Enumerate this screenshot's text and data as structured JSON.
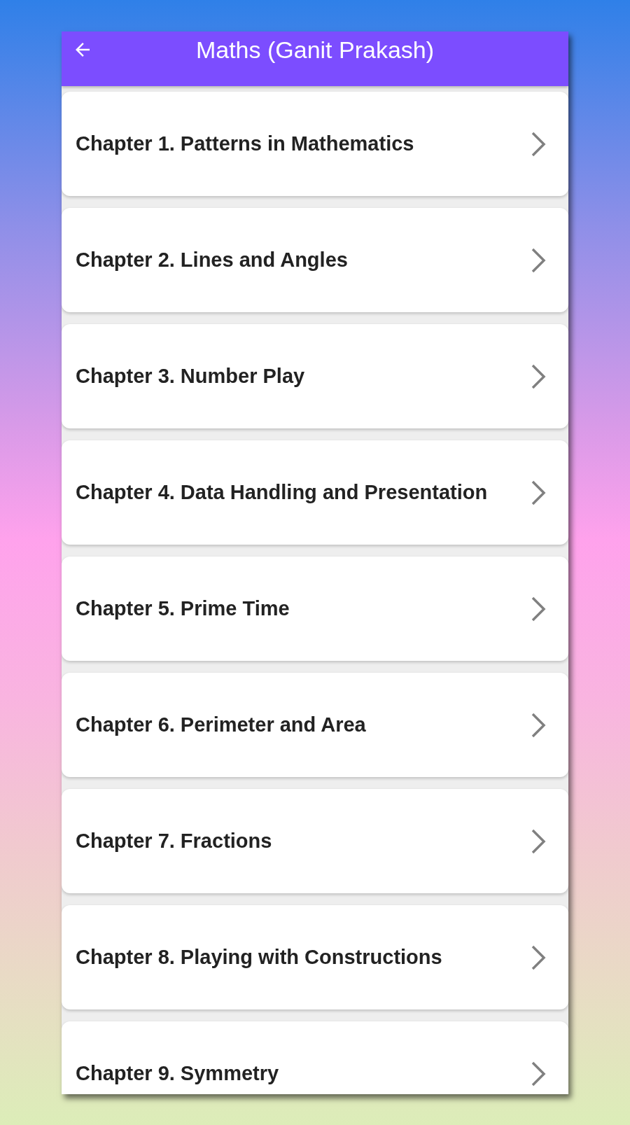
{
  "app_bar": {
    "title": "Maths (Ganit Prakash)"
  },
  "chapters": [
    {
      "title": "Chapter 1. Patterns in Mathematics"
    },
    {
      "title": "Chapter 2. Lines and Angles"
    },
    {
      "title": "Chapter 3. Number Play"
    },
    {
      "title": "Chapter 4. Data Handling and Presentation"
    },
    {
      "title": "Chapter 5. Prime Time"
    },
    {
      "title": "Chapter 6. Perimeter and Area"
    },
    {
      "title": "Chapter 7. Fractions"
    },
    {
      "title": "Chapter 8. Playing with Constructions"
    },
    {
      "title": "Chapter 9. Symmetry"
    }
  ]
}
